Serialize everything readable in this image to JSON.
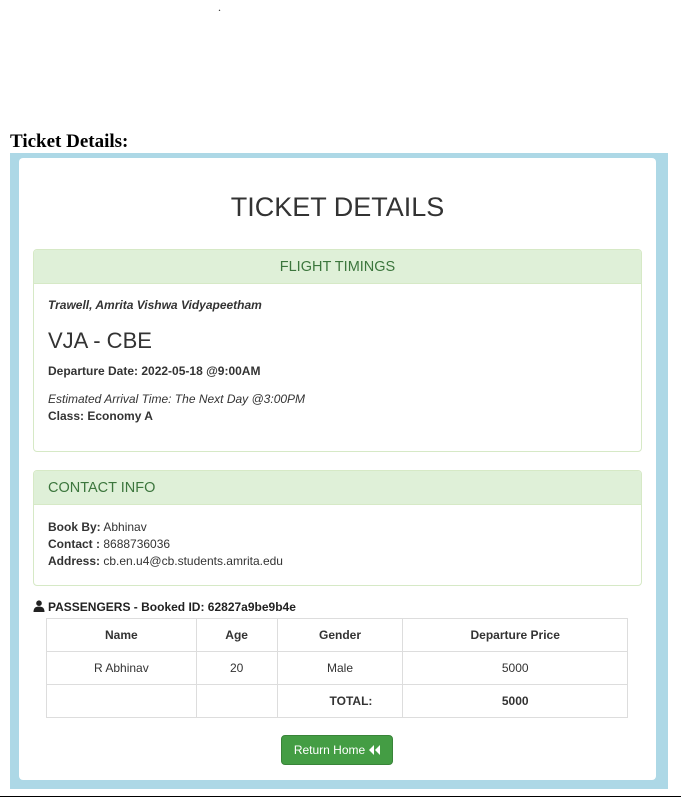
{
  "top_mark": ".",
  "section_heading": "Ticket Details:",
  "card": {
    "title": "TICKET DETAILS",
    "flight": {
      "header": "FLIGHT TIMINGS",
      "agency": "Trawell, Amrita Vishwa Vidyapeetham",
      "route": "VJA - CBE",
      "departure": "Departure Date: 2022-05-18 @9:00AM",
      "arrival": "Estimated Arrival Time: The Next Day @3:00PM",
      "class": "Class: Economy A"
    },
    "contact": {
      "header": "CONTACT INFO",
      "book_by_label": "Book By:",
      "book_by": "Abhinav",
      "contact_label": "Contact :",
      "contact": "8688736036",
      "address_label": "Address:",
      "address": "cb.en.u4@cb.students.amrita.edu"
    },
    "passengers": {
      "title": "PASSENGERS - Booked ID: 62827a9be9b4e",
      "icon": "user-icon",
      "columns": [
        "Name",
        "Age",
        "Gender",
        "Departure Price"
      ],
      "rows": [
        {
          "name": "R Abhinav",
          "age": "20",
          "gender": "Male",
          "price": "5000"
        }
      ],
      "total_label": "TOTAL:",
      "total_value": "5000"
    },
    "return_button": {
      "label": "Return Home",
      "icon": "double-chevron-left-icon"
    }
  },
  "colors": {
    "outer_bg": "#add8e6",
    "panel_heading_bg": "#dff0d8",
    "panel_heading_text": "#3c763d",
    "button_bg": "#449d44"
  }
}
